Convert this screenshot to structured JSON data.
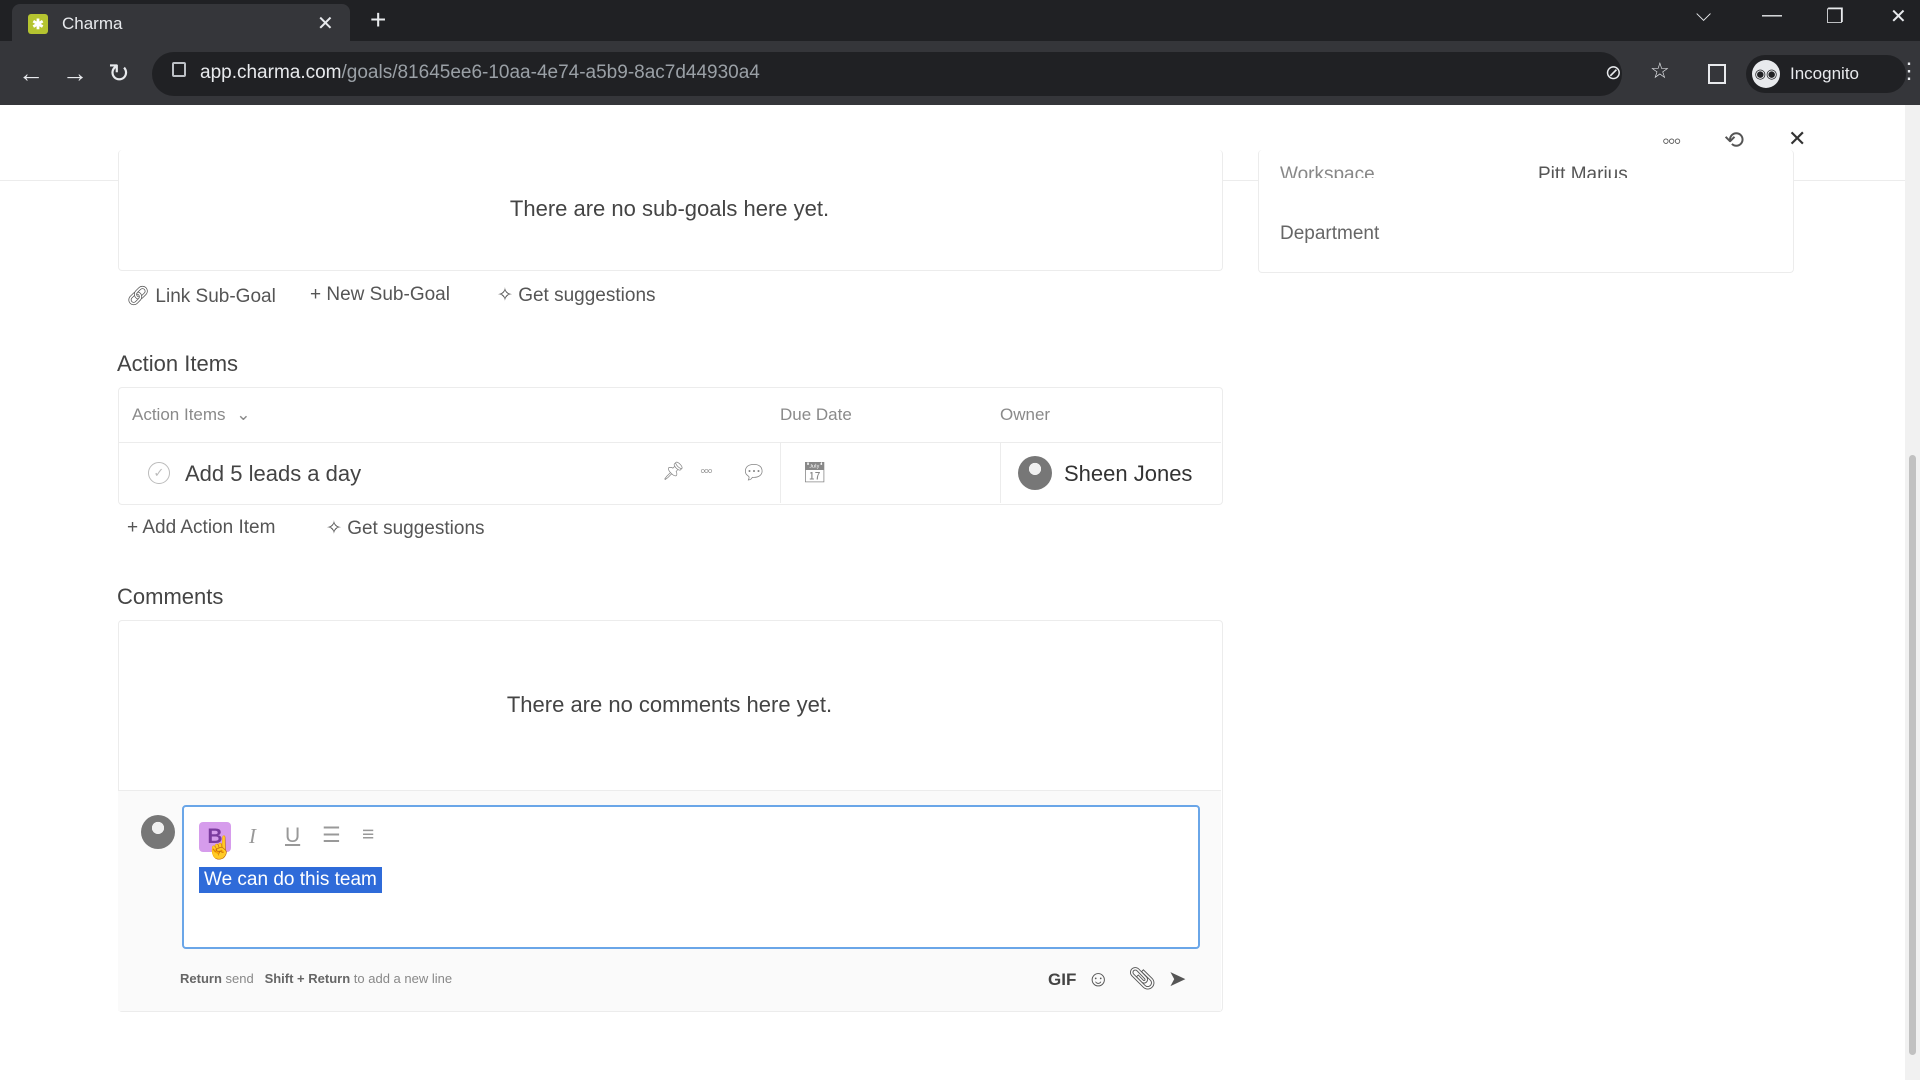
{
  "browser": {
    "tab_title": "Charma",
    "url_host": "app.charma.com",
    "url_path": "/goals/81645ee6-10aa-4e74-a5b9-8ac7d44930a4",
    "profile_label": "Incognito"
  },
  "sidebar_panel": {
    "partial_workspace_label": "Workspace",
    "partial_workspace_value": "Pitt Marius",
    "department_label": "Department"
  },
  "subgoals": {
    "empty_text": "There are no sub-goals here yet.",
    "link_label": "Link Sub-Goal",
    "new_label": "New Sub-Goal",
    "suggest_label": "Get suggestions"
  },
  "action_items": {
    "section_title": "Action Items",
    "columns": [
      "Action Items",
      "Due Date",
      "Owner"
    ],
    "rows": [
      {
        "title": "Add 5 leads a day",
        "owner": "Sheen Jones"
      }
    ],
    "add_label": "Add Action Item",
    "suggest_label": "Get suggestions"
  },
  "comments": {
    "section_title": "Comments",
    "empty_text": "There are no comments here yet.",
    "editor_text": "We can do this team",
    "hint_return": "Return",
    "hint_send": "send",
    "hint_shift": "Shift + Return",
    "hint_newline": "to add a new line",
    "gif_label": "GIF"
  },
  "colors": {
    "accent_blue": "#2f6bd9",
    "bold_active": "#d69cec",
    "editor_border": "#6aa6e8"
  }
}
